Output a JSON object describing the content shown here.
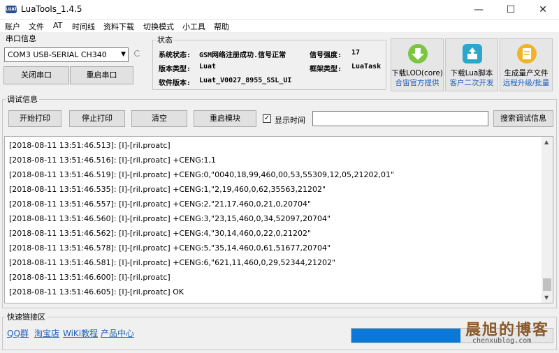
{
  "window": {
    "title": "LuaTools_1.4.5",
    "logo_text": "LUAT",
    "minimize": "—",
    "maximize": "☐",
    "close": "✕"
  },
  "menu": [
    "账户",
    "文件",
    "AT",
    "时间线",
    "资料下载",
    "切换模式",
    "小工具",
    "帮助"
  ],
  "serial": {
    "group_label": "串口信息",
    "port_value": "COM3 USB-SERIAL CH340",
    "close_button": "关闭串口",
    "restart_button": "重启串口"
  },
  "status": {
    "group_label": "状态",
    "system_label": "系统状态:",
    "system_value": "GSM网络注册成功.信号正常",
    "signal_label": "信号强度:",
    "signal_value": "17",
    "version_type_label": "版本类型:",
    "version_type_value": "Luat",
    "framework_label": "框架类型:",
    "framework_value": "LuaTask",
    "software_label": "软件版本:",
    "software_value": "Luat_V0027_8955_SSL_UI"
  },
  "actions": [
    {
      "line1": "下载LOD(core)",
      "line2": "合宙官方提供",
      "icon": "download-arrow-icon",
      "color": "#7cc540"
    },
    {
      "line1": "下载Lua脚本",
      "line2": "客户二次开发",
      "icon": "upload-box-icon",
      "color": "#2aa7c9"
    },
    {
      "line1": "生成量产文件",
      "line2": "远程升级/批量",
      "icon": "document-icon",
      "color": "#f0b429"
    }
  ],
  "debug": {
    "group_label": "调试信息",
    "start_print": "开始打印",
    "stop_print": "停止打印",
    "clear": "清空",
    "restart_module": "重启模块",
    "show_time_label": "显示时间",
    "show_time_checked": "✓",
    "search_button": "搜索调试信息",
    "log_lines": [
      "[2018-08-11 13:51:46.513]: [I]-[ril.proatc]",
      "[2018-08-11 13:51:46.516]: [I]-[ril.proatc]  +CENG:1,1",
      "[2018-08-11 13:51:46.519]: [I]-[ril.proatc]  +CENG:0,\"0040,18,99,460,00,53,55309,12,05,21202,01\"",
      "[2018-08-11 13:51:46.535]: [I]-[ril.proatc]  +CENG:1,\"2,19,460,0,62,35563,21202\"",
      "[2018-08-11 13:51:46.557]: [I]-[ril.proatc]  +CENG:2,\"21,17,460,0,21,0,20704\"",
      "[2018-08-11 13:51:46.560]: [I]-[ril.proatc]  +CENG:3,\"23,15,460,0,34,52097,20704\"",
      "[2018-08-11 13:51:46.562]: [I]-[ril.proatc]  +CENG:4,\"30,14,460,0,22,0,21202\"",
      "[2018-08-11 13:51:46.578]: [I]-[ril.proatc]  +CENG:5,\"35,14,460,0,61,51677,20704\"",
      "[2018-08-11 13:51:46.581]: [I]-[ril.proatc]  +CENG:6,\"621,11,460,0,29,52344,21202\"",
      "[2018-08-11 13:51:46.600]: [I]-[ril.proatc]",
      "[2018-08-11 13:51:46.605]: [I]-[ril.proatc]  OK"
    ],
    "scroll_up": "▲",
    "scroll_down": "▼"
  },
  "quick_links": {
    "group_label": "快速链接区",
    "links": [
      "QQ群",
      "淘宝店",
      "WiKi教程",
      "产品中心"
    ],
    "progress_fraction": 0.54
  },
  "watermark": {
    "title": "晨旭的博客",
    "url": "chenxublog.com"
  }
}
